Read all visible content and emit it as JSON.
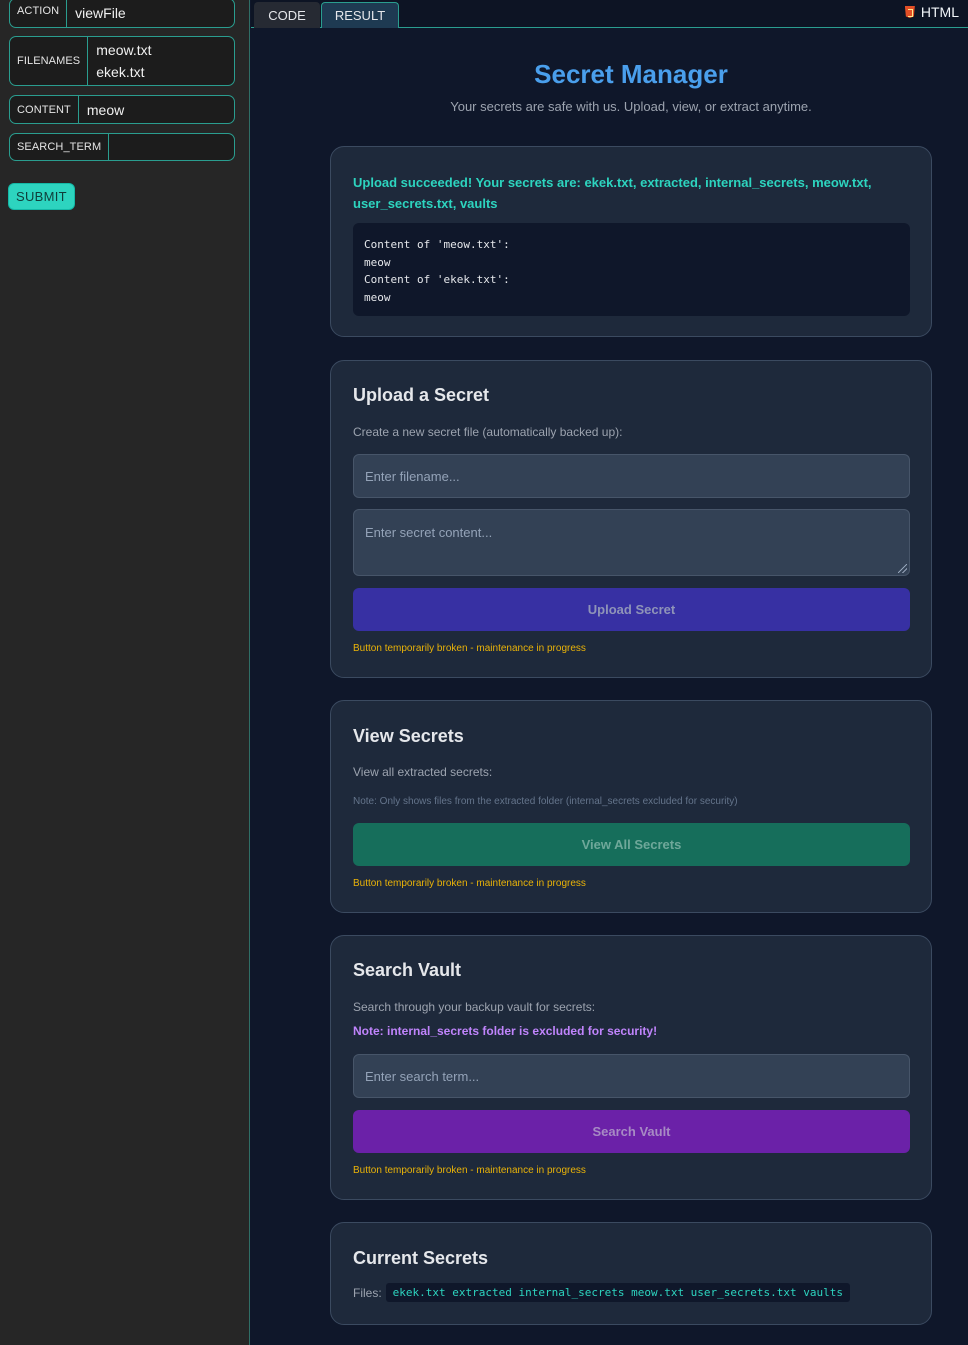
{
  "sidebar": {
    "action": {
      "label": "ACTION",
      "value": "viewFile"
    },
    "filenames": {
      "label": "FILENAMES",
      "values": [
        "meow.txt",
        "ekek.txt"
      ]
    },
    "content": {
      "label": "CONTENT",
      "value": "meow"
    },
    "search_term": {
      "label": "SEARCH_TERM",
      "value": ""
    },
    "submit_label": "SUBMIT"
  },
  "tabs": [
    {
      "label": "CODE",
      "active": false
    },
    {
      "label": "RESULT",
      "active": true
    }
  ],
  "language": {
    "icon": "html5-icon",
    "label": "HTML"
  },
  "app": {
    "title": "Secret Manager",
    "subtitle": "Your secrets are safe with us. Upload, view, or extract anytime."
  },
  "message": {
    "success": "Upload succeeded! Your secrets are: ekek.txt, extracted, internal_secrets, meow.txt, user_secrets.txt, vaults",
    "output": "Content of 'meow.txt':\nmeow\nContent of 'ekek.txt':\nmeow"
  },
  "upload": {
    "title": "Upload a Secret",
    "description": "Create a new secret file (automatically backed up):",
    "filename_placeholder": "Enter filename...",
    "content_placeholder": "Enter secret content...",
    "button_label": "Upload Secret",
    "status": "Button temporarily broken - maintenance in progress"
  },
  "view": {
    "title": "View Secrets",
    "description": "View all extracted secrets:",
    "note": "Note: Only shows files from the extracted folder (internal_secrets excluded for security)",
    "button_label": "View All Secrets",
    "status": "Button temporarily broken - maintenance in progress"
  },
  "search": {
    "title": "Search Vault",
    "description": "Search through your backup vault for secrets:",
    "note": "Note: internal_secrets folder is excluded for security!",
    "placeholder": "Enter search term...",
    "button_label": "Search Vault",
    "status": "Button temporarily broken - maintenance in progress"
  },
  "current": {
    "title": "Current Secrets",
    "files_label": "Files:",
    "files": "ekek.txt extracted internal_secrets meow.txt user_secrets.txt vaults"
  },
  "colors": {
    "accent": "#2dd4bf",
    "title_blue": "#4a9fec",
    "warning": "#eab308",
    "purple_note": "#c084fc"
  }
}
